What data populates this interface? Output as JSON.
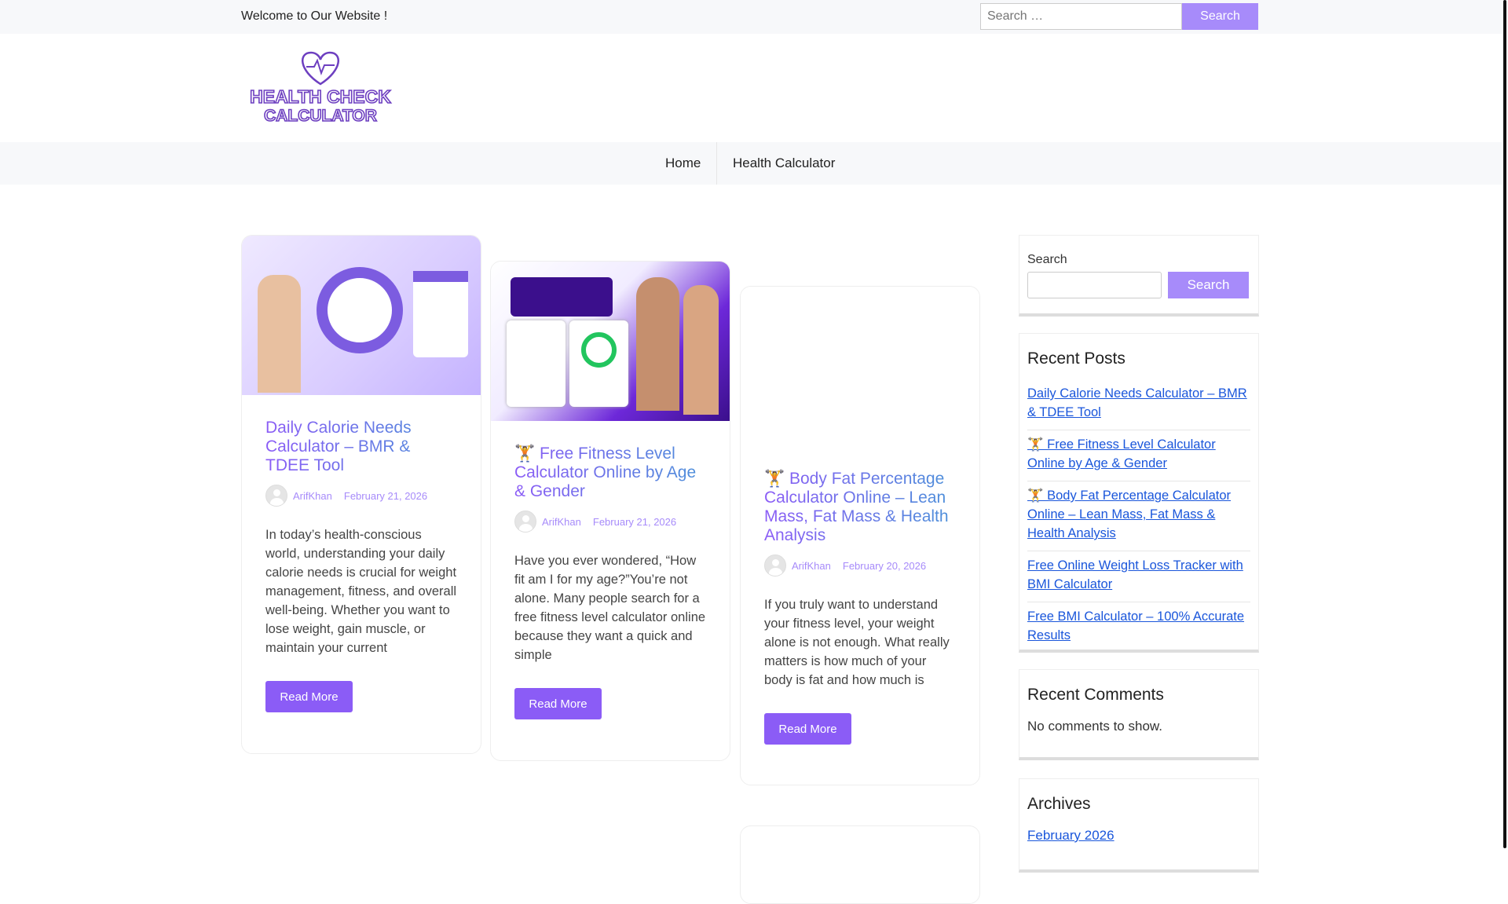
{
  "topbar": {
    "welcome": "Welcome to Our Website !",
    "search_placeholder": "Search …",
    "search_button": "Search"
  },
  "logo": {
    "text_line1": "HEALTH CHECK",
    "text_line2": "CALCULATOR"
  },
  "nav": {
    "items": [
      {
        "label": "Home"
      },
      {
        "label": "Health Calculator"
      }
    ]
  },
  "posts": [
    {
      "emoji": "",
      "title": "Daily Calorie Needs Calculator – BMR & TDEE Tool",
      "author": "ArifKhan",
      "date": "February 21, 2026",
      "excerpt": "In today’s health-conscious world, understanding your daily calorie needs is crucial for weight management, fitness, and overall well-being. Whether you want to lose weight, gain muscle, or maintain your current",
      "read_more": "Read More"
    },
    {
      "emoji": "🏋️",
      "title": "Free Fitness Level Calculator Online by Age & Gender",
      "author": "ArifKhan",
      "date": "February 21, 2026",
      "excerpt": "Have you ever wondered, “How fit am I for my age?”You’re not alone. Many people search for a free fitness level calculator online because they want a quick and simple",
      "read_more": "Read More"
    },
    {
      "emoji": "🏋️",
      "title": "Body Fat Percentage Calculator Online – Lean Mass, Fat Mass & Health Analysis",
      "author": "ArifKhan",
      "date": "February 20, 2026",
      "excerpt": "If you truly want to understand your fitness level, your weight alone is not enough. What really matters is how much of your body is fat and how much is",
      "read_more": "Read More"
    }
  ],
  "sidebar": {
    "search": {
      "label": "Search",
      "button": "Search"
    },
    "recent_posts": {
      "title": "Recent Posts",
      "items": [
        "Daily Calorie Needs Calculator – BMR & TDEE Tool",
        "🏋️ Free Fitness Level Calculator Online by Age & Gender",
        "🏋️ Body Fat Percentage Calculator Online – Lean Mass, Fat Mass & Health Analysis",
        "Free Online Weight Loss Tracker with BMI Calculator",
        "Free BMI Calculator – 100% Accurate Results"
      ]
    },
    "recent_comments": {
      "title": "Recent Comments",
      "empty": "No comments to show."
    },
    "archives": {
      "title": "Archives",
      "items": [
        "February 2026"
      ]
    }
  },
  "colors": {
    "accent": "#8b5cf6",
    "button_light": "#a78bfa",
    "link": "#1a56db"
  }
}
